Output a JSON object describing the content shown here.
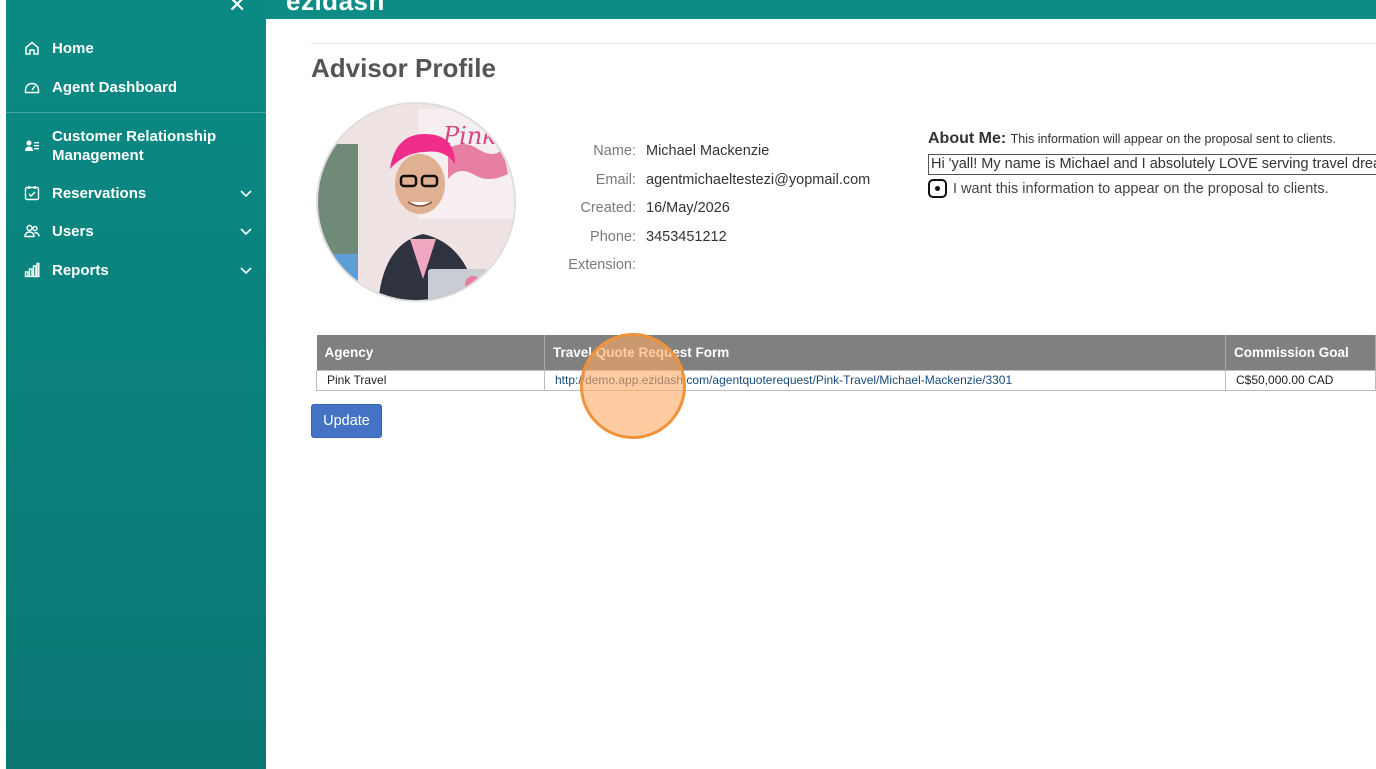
{
  "app": {
    "brand": "ezidash"
  },
  "sidebar": {
    "items": [
      {
        "label": "Home",
        "icon": "home-icon"
      },
      {
        "label": "Agent Dashboard",
        "icon": "gauge-icon"
      },
      {
        "label": "Customer Relationship Management",
        "icon": "contact-card-icon"
      },
      {
        "label": "Reservations",
        "icon": "calendar-check-icon"
      },
      {
        "label": "Users",
        "icon": "users-icon"
      },
      {
        "label": "Reports",
        "icon": "bar-chart-icon"
      }
    ]
  },
  "page": {
    "title": "Advisor Profile"
  },
  "profile": {
    "name_label": "Name:",
    "name": "Michael Mackenzie",
    "email_label": "Email:",
    "email": "agentmichaeltestezi@yopmail.com",
    "created_label": "Created:",
    "created": "16/May/2026",
    "phone_label": "Phone:",
    "phone": "3453451212",
    "extension_label": "Extension:",
    "extension": ""
  },
  "about": {
    "heading": "About Me:",
    "note": "This information will appear on the proposal sent to clients.",
    "text": "Hi 'yall! My name is Michael and I absolutely LOVE serving travel dreamers",
    "checkbox_label": "I want this information to appear on the proposal to clients."
  },
  "table": {
    "headers": [
      "Agency",
      "Travel Quote Request Form",
      "Commission Goal"
    ],
    "rows": [
      [
        "Pink Travel",
        "http://demo.app.ezidash.com/agentquoterequest/Pink-Travel/Michael-Mackenzie/3301",
        "C$50,000.00 CAD"
      ]
    ]
  },
  "buttons": {
    "update": "Update"
  },
  "colors": {
    "sidebar": "#0b8a84",
    "header": "#80808",
    "button": "#4472c4"
  }
}
